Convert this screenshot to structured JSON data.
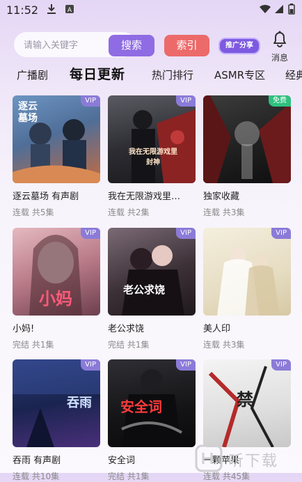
{
  "status_bar": {
    "time": "11:52"
  },
  "header": {
    "search_placeholder": "请输入关键字",
    "search_button": "搜索",
    "index_button": "索引",
    "share_button": "推广分享",
    "message_label": "消息"
  },
  "tabs": [
    {
      "label": "广播剧"
    },
    {
      "label": "每日更新",
      "active": true
    },
    {
      "label": "热门排行"
    },
    {
      "label": "ASMR专区"
    },
    {
      "label": "经典"
    }
  ],
  "items": [
    {
      "title": "逐云墓场 有声剧",
      "meta": "连载 共5集",
      "badge": "VIP",
      "cover_text": "逐云\n墓场",
      "colors": [
        "#5d7fa8",
        "#c96a46"
      ]
    },
    {
      "title": "我在无限游戏里…",
      "meta": "连载 共2集",
      "badge": "VIP",
      "cover_text": "我在无限游戏里封神",
      "colors": [
        "#3a3a40",
        "#9b2a2a"
      ]
    },
    {
      "title": "独家收藏",
      "meta": "连载 共3集",
      "badge": "免费",
      "badge_type": "free",
      "cover_text": "",
      "colors": [
        "#2a2a2a",
        "#8a2020"
      ]
    },
    {
      "title": "小妈!",
      "meta": "完结 共1集",
      "badge": "VIP",
      "cover_text": "小妈",
      "colors": [
        "#c98a96",
        "#6a4050"
      ]
    },
    {
      "title": "老公求饶",
      "meta": "完结 共1集",
      "badge": "VIP",
      "cover_text": "老公求饶",
      "colors": [
        "#5a4a55",
        "#2c2128"
      ]
    },
    {
      "title": "美人印",
      "meta": "连载 共3集",
      "badge": "VIP",
      "cover_text": "",
      "colors": [
        "#e9e2cc",
        "#c9b88a"
      ]
    },
    {
      "title": "吞雨 有声剧",
      "meta": "连载 共10集",
      "badge": "VIP",
      "cover_text": "吞雨",
      "colors": [
        "#1b2a5a",
        "#4a2f7a"
      ]
    },
    {
      "title": "安全词",
      "meta": "完结 共1集",
      "badge": "VIP",
      "cover_text": "安全词",
      "colors": [
        "#1a1a1e",
        "#5a1a1a"
      ]
    },
    {
      "title": "一颗苹果",
      "meta": "连载 共45集",
      "badge": "VIP",
      "cover_text": "禁",
      "colors": [
        "#eeeeee",
        "#b52a2a"
      ]
    }
  ],
  "watermark": {
    "text": "听下载"
  }
}
